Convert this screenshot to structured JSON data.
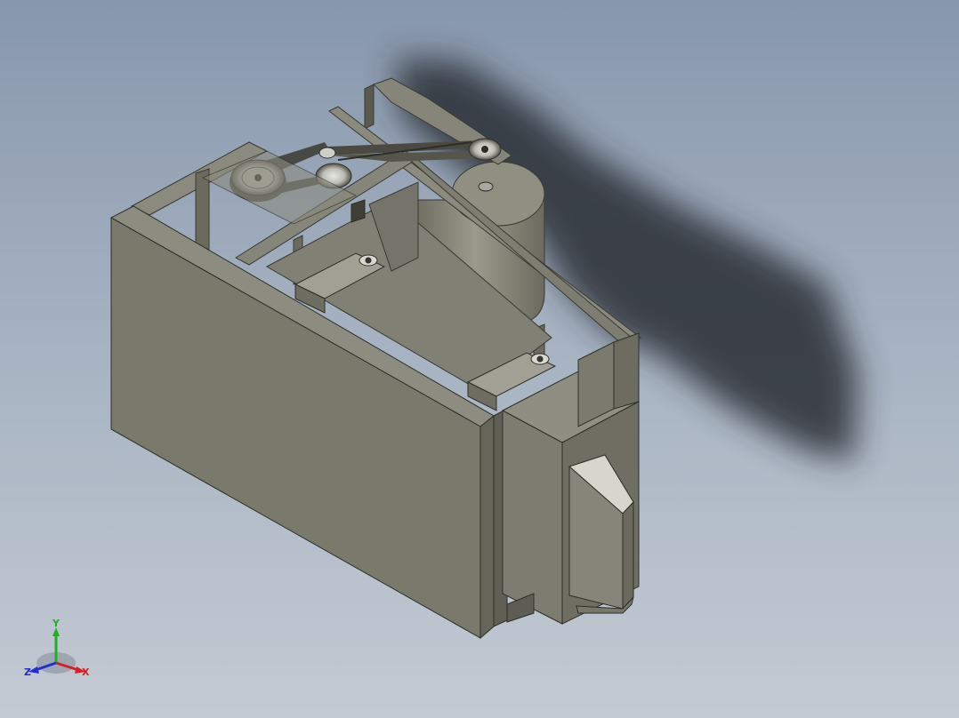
{
  "viewport": {
    "background_top": "#8797ac",
    "background_bottom": "#c3cad3"
  },
  "model": {
    "body_color": "#7a7a6c",
    "frame_color": "#6e6e62",
    "shadow_color": "#2a2e34"
  },
  "triad": {
    "y_label": "Y",
    "x_label": "X",
    "z_label": "Z",
    "x_color": "#d62020",
    "y_color": "#20b020",
    "z_color": "#2030d0"
  }
}
